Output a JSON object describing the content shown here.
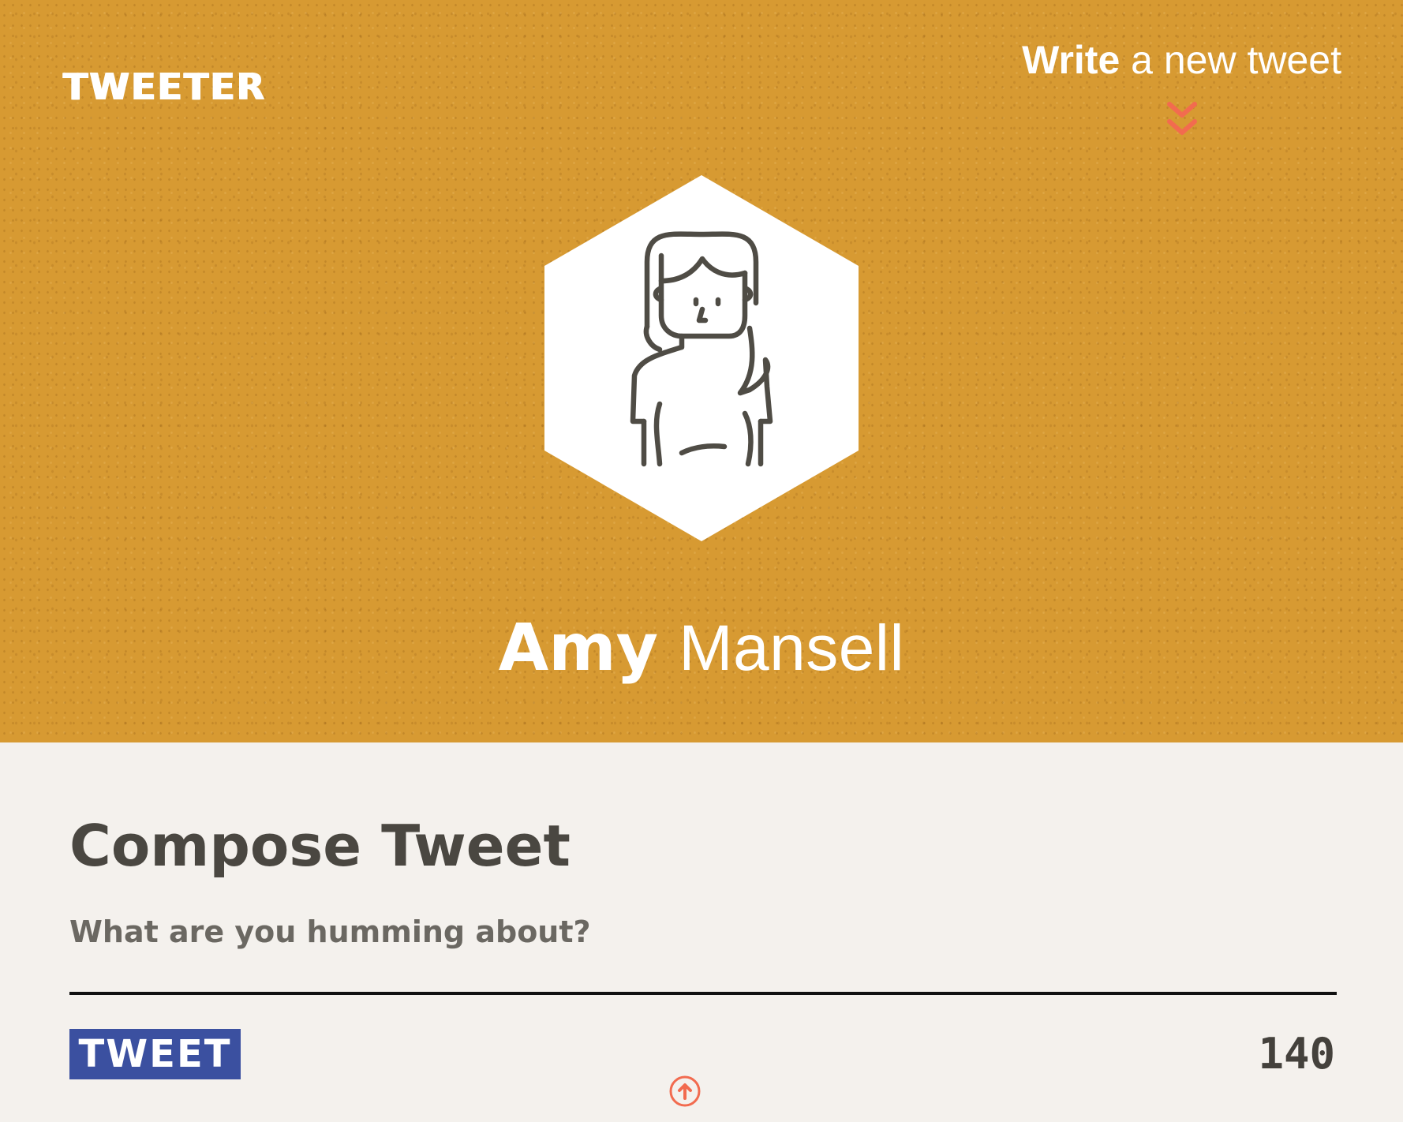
{
  "header": {
    "logo": "TWEETER",
    "write_link": {
      "strong": "Write",
      "light": " a new tweet"
    },
    "scroll_icon": "double-chevron-down-icon"
  },
  "profile": {
    "avatar_icon": "woman-avatar-icon",
    "first_name": "Amy",
    "last_name": "Mansell"
  },
  "compose": {
    "title": "Compose Tweet",
    "placeholder": "What are you humming about?",
    "value": "",
    "button_label": "TWEET",
    "char_count": "140"
  },
  "footer": {
    "scroll_top_icon": "arrow-up-circle-icon"
  },
  "colors": {
    "hero_background": "#d79a32",
    "accent": "#f26b4f",
    "button": "#3b50a0",
    "text_dark": "#4a4741",
    "page_background": "#f4f1ed"
  }
}
